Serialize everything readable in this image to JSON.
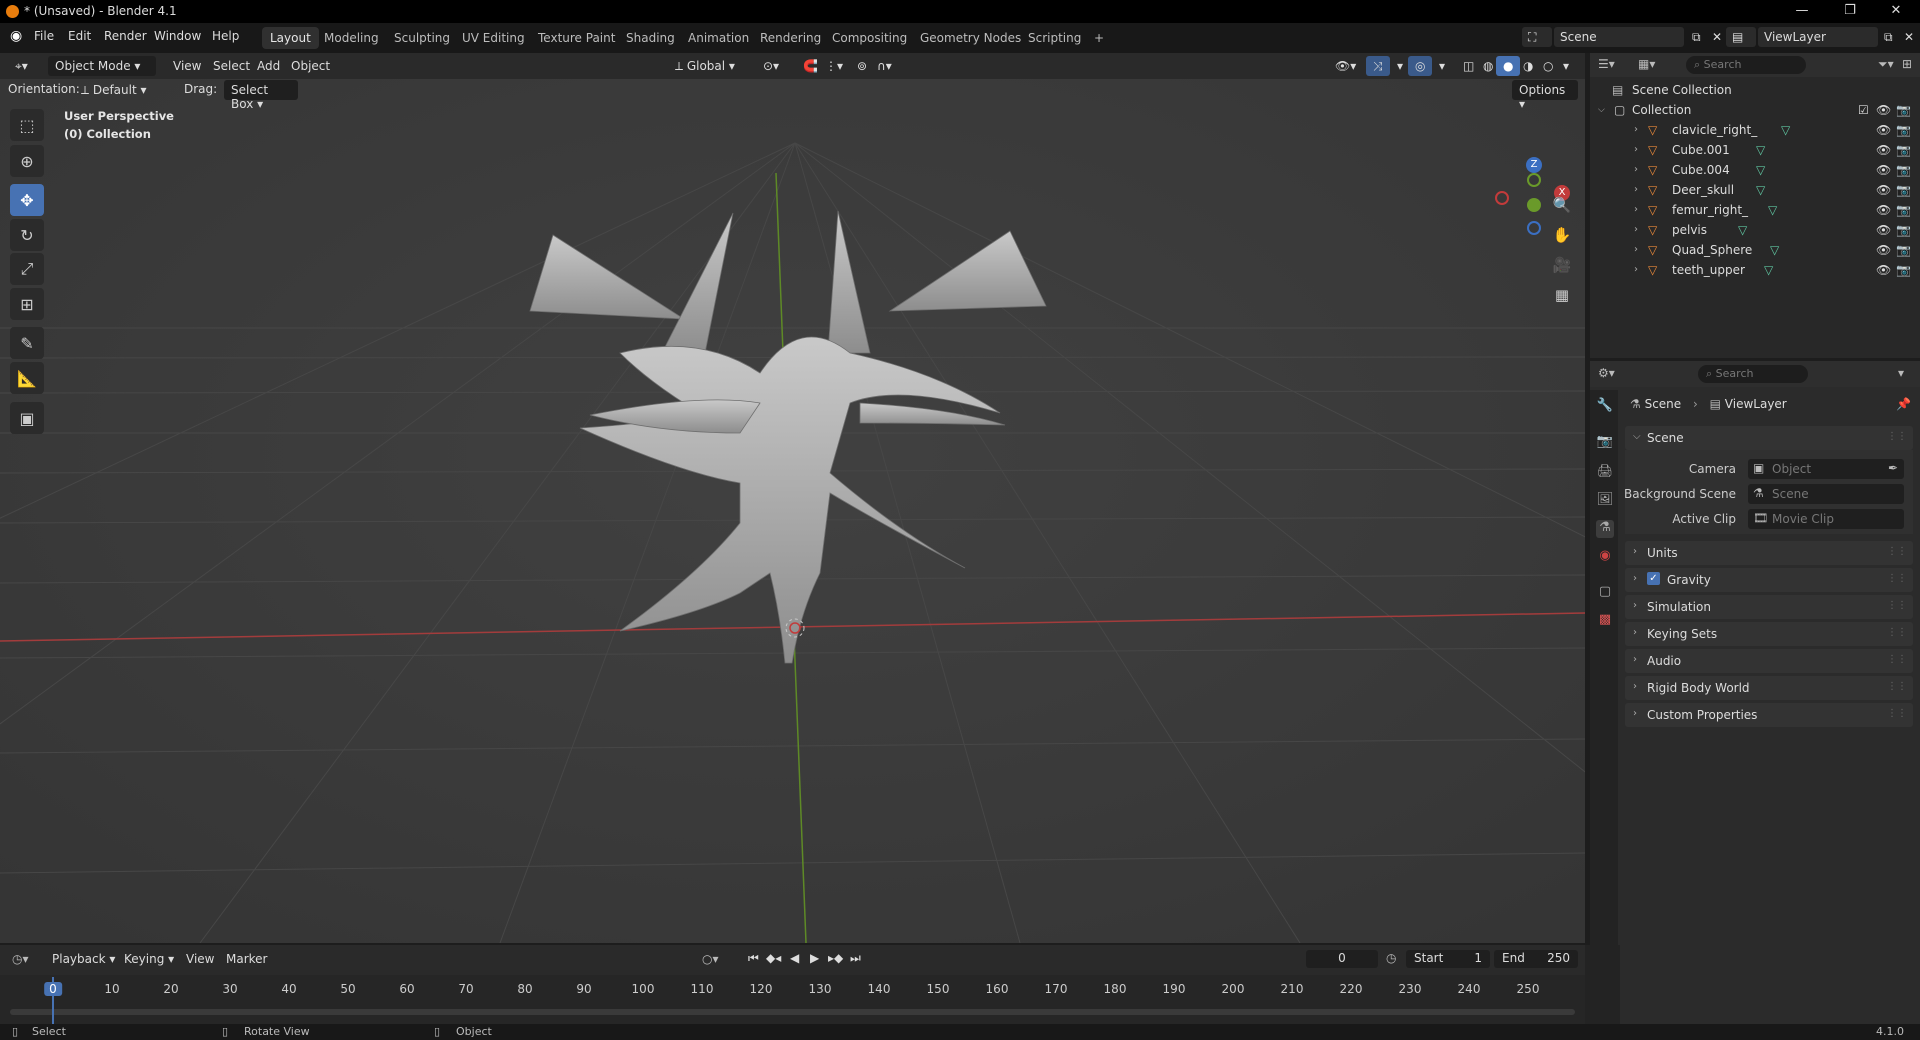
{
  "window": {
    "title": "* (Unsaved) - Blender 4.1",
    "minimize": "—",
    "maximize": "❐",
    "close": "✕"
  },
  "menus": [
    "File",
    "Edit",
    "Render",
    "Window",
    "Help"
  ],
  "workspaces": [
    "Layout",
    "Modeling",
    "Sculpting",
    "UV Editing",
    "Texture Paint",
    "Shading",
    "Animation",
    "Rendering",
    "Compositing",
    "Geometry Nodes",
    "Scripting"
  ],
  "scene_selector": "Scene",
  "view_layer_selector": "ViewLayer",
  "viewport_header": {
    "mode": "Object Mode",
    "menus": [
      "View",
      "Select",
      "Add",
      "Object"
    ],
    "transform_orientation": "Global",
    "options": "Options"
  },
  "viewport_options": {
    "orientation_label": "Orientation:",
    "orientation_value": "Default",
    "drag_label": "Drag:",
    "drag_value": "Select Box"
  },
  "viewport_info": {
    "line1": "User Perspective",
    "line2": "(0) Collection"
  },
  "gizmo": {
    "z": "Z",
    "y": "Y",
    "x": "X"
  },
  "outliner": {
    "search_placeholder": "Search",
    "root": "Scene Collection",
    "collection": "Collection",
    "objects": [
      "clavicle_right_",
      "Cube.001",
      "Cube.004",
      "Deer_skull",
      "femur_right_",
      "pelvis",
      "Quad_Sphere",
      "teeth_upper"
    ]
  },
  "properties": {
    "search_placeholder": "Search",
    "breadcrumb_scene": "Scene",
    "breadcrumb_viewlayer": "ViewLayer",
    "scene_panel": "Scene",
    "camera_label": "Camera",
    "camera_placeholder": "Object",
    "bg_scene_label": "Background Scene",
    "bg_scene_placeholder": "Scene",
    "active_clip_label": "Active Clip",
    "active_clip_placeholder": "Movie Clip",
    "panels": [
      "Units",
      "Gravity",
      "Simulation",
      "Keying Sets",
      "Audio",
      "Rigid Body World",
      "Custom Properties"
    ],
    "gravity_checked": true
  },
  "timeline": {
    "menus": [
      "Playback",
      "Keying",
      "View",
      "Marker"
    ],
    "current_frame": "0",
    "start_label": "Start",
    "start_value": "1",
    "end_label": "End",
    "end_value": "250",
    "ticks": [
      "0",
      "10",
      "20",
      "30",
      "40",
      "50",
      "60",
      "70",
      "80",
      "90",
      "100",
      "110",
      "120",
      "130",
      "140",
      "150",
      "160",
      "170",
      "180",
      "190",
      "200",
      "210",
      "220",
      "230",
      "240",
      "250"
    ]
  },
  "statusbar": {
    "select": "Select",
    "rotate": "Rotate View",
    "object": "Object",
    "version": "4.1.0"
  },
  "colors": {
    "accent": "#4772b3",
    "x_axis": "#c23b3b",
    "y_axis": "#6a9a2a",
    "z_axis": "#3b6fc2",
    "object_orange": "#e8883a",
    "mesh_green": "#5fc4a0"
  }
}
